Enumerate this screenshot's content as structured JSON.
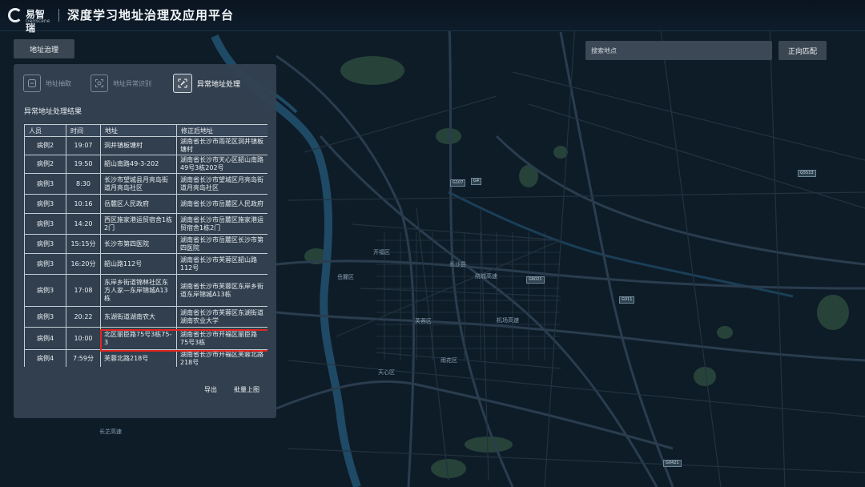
{
  "header": {
    "logo_text": "易智瑞",
    "logo_sub": "GeoScene",
    "title": "深度学习地址治理及应用平台"
  },
  "nav": {
    "address_governance": "地址治理"
  },
  "search": {
    "placeholder": "搜索地点",
    "match_button": "正向匹配"
  },
  "panel": {
    "tabs": [
      {
        "label": "地址抽取",
        "icon": "address-extract-icon"
      },
      {
        "label": "地址异常识别",
        "icon": "anomaly-detect-icon"
      },
      {
        "label": "异常地址处理",
        "icon": "address-fix-icon"
      }
    ],
    "section_title": "异常地址处理结果",
    "columns": [
      "人员",
      "时间",
      "地址",
      "修正后地址"
    ],
    "rows": [
      {
        "person": "病例2",
        "time": "19:07",
        "address": "洞井镇板塘村",
        "corrected": "湖南省长沙市雨花区洞井镇板塘村"
      },
      {
        "person": "病例2",
        "time": "19:50",
        "address": "韶山南路49-3-202",
        "corrected": "湖南省长沙市天心区韶山南路49号3栋202号"
      },
      {
        "person": "病例3",
        "time": "8:30",
        "address": "长沙市望城县月亮岛街道月亮岛社区",
        "corrected": "湖南省长沙市望城区月亮岛街道月亮岛社区"
      },
      {
        "person": "病例3",
        "time": "10:16",
        "address": "岳麓区人民政府",
        "corrected": "湖南省长沙市岳麓区人民政府"
      },
      {
        "person": "病例3",
        "time": "14:20",
        "address": "西区施家港运贸宿舍1栋2门",
        "corrected": "湖南省长沙市岳麓区施家港运贸宿舍1栋2门"
      },
      {
        "person": "病例3",
        "time": "15:15分",
        "address": "长沙市第四医院",
        "corrected": "湖南省长沙市岳麓区长沙市第四医院"
      },
      {
        "person": "病例3",
        "time": "16:20分",
        "address": "韶山路112号",
        "corrected": "湖南省长沙市芙蓉区韶山路112号"
      },
      {
        "person": "病例3",
        "time": "17:08",
        "address": "东岸乡街道锦林社区东方人家—东岸锦城A13栋",
        "corrected": "湖南省长沙市芙蓉区东岸乡街道东岸锦城A13栋"
      },
      {
        "person": "病例3",
        "time": "20:22",
        "address": "东湖街道湖南农大",
        "corrected": "湖南省长沙市芙蓉区东湖街道湖南农业大学"
      },
      {
        "person": "病例4",
        "time": "10:00",
        "address": "北区丽臣路75号3栋75-3",
        "corrected": "湖南省长沙市开福区丽臣路75号3栋"
      },
      {
        "person": "病例4",
        "time": "7:59分",
        "address": "芙蓉北路218号",
        "corrected": "湖南省长沙市开福区芙蓉北路218号"
      }
    ],
    "export_label": "导出",
    "batch_map_label": "批量上图"
  },
  "map_labels": [
    "开福区",
    "岳麓区",
    "长沙县",
    "芙蓉区",
    "天心区",
    "雨花区",
    "长沙县",
    "长沙县"
  ],
  "map_roads": [
    "G107",
    "G4",
    "G5513",
    "G0421",
    "G0401",
    "长芷高速",
    "机场高速",
    "绕城高速",
    "G6021",
    "G011",
    "G0422"
  ],
  "colors": {
    "accent_red": "#e2261f",
    "panel_bg": "#344252",
    "map_bg": "#0d1a26"
  }
}
